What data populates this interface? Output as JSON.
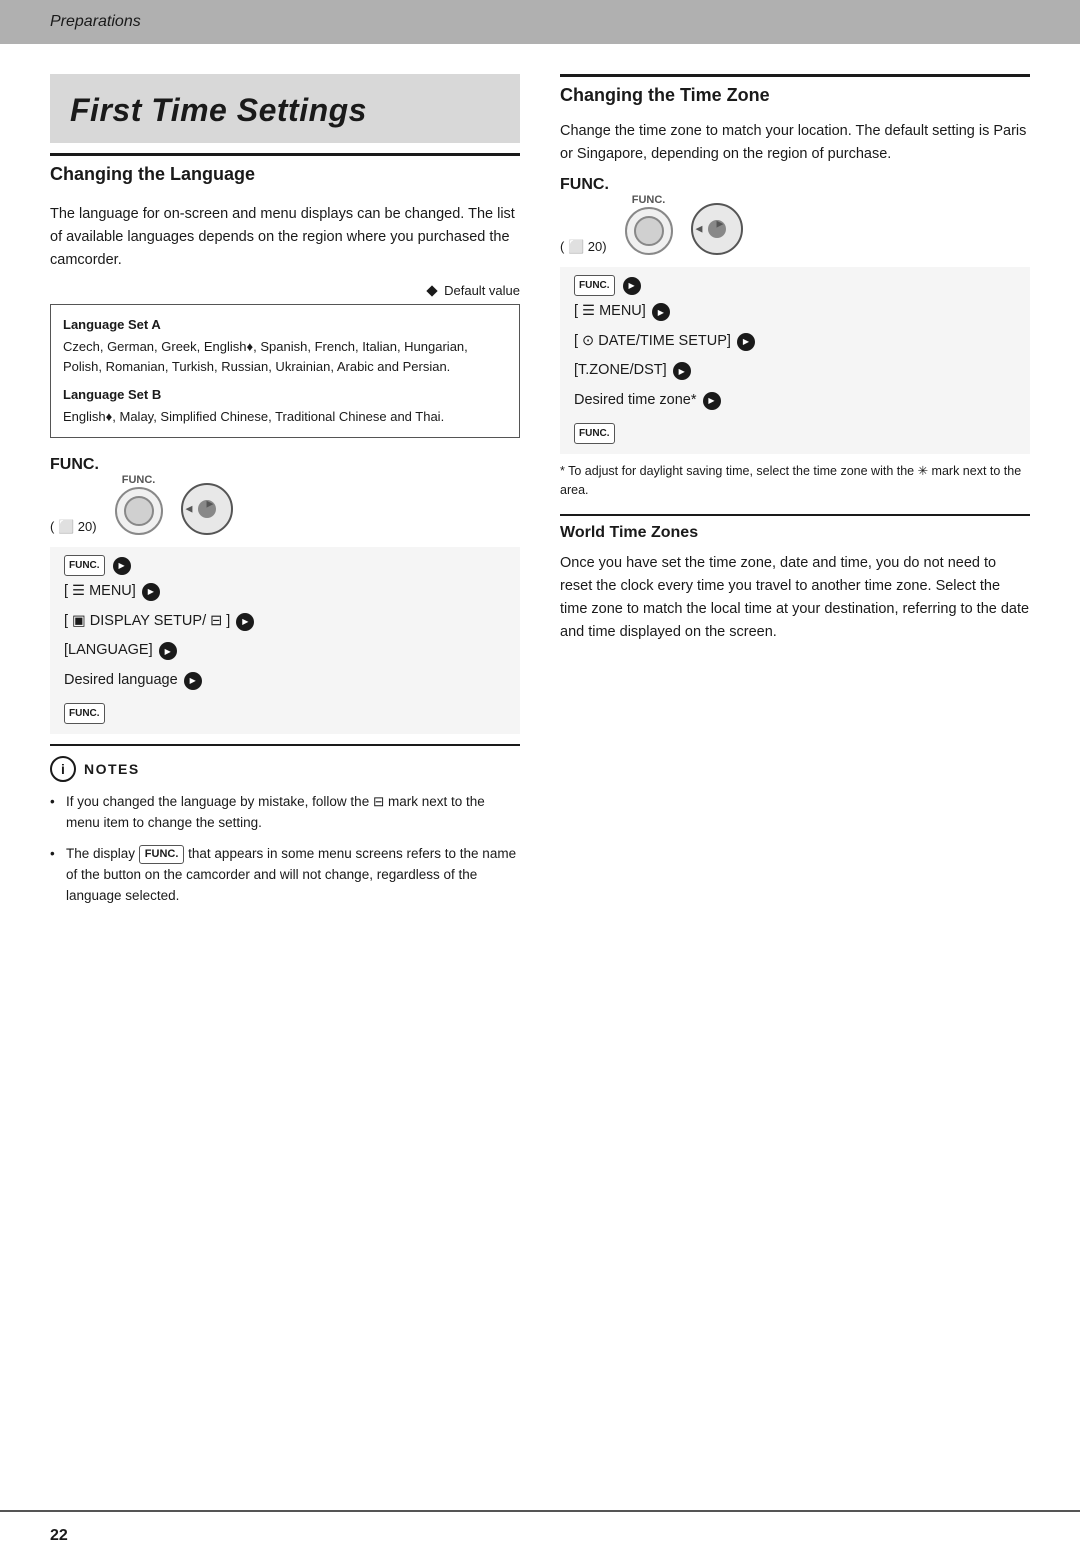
{
  "topBar": {
    "title": "Preparations"
  },
  "leftCol": {
    "mainTitle": "First Time Settings",
    "changingLanguage": {
      "heading": "Changing the Language",
      "bodyText": "The language for on-screen and menu displays can be changed. The list of available languages depends on the region where you purchased the camcorder.",
      "defaultValueLabel": "Default value",
      "languageSetATitle": "Language Set A",
      "languageSetAText": "Czech, German, Greek, English♦, Spanish, French, Italian, Hungarian, Polish, Romanian, Turkish, Russian, Ukrainian, Arabic and Persian.",
      "languageSetBTitle": "Language Set B",
      "languageSetBText": "English♦, Malay, Simplified Chinese, Traditional Chinese and Thai.",
      "funcLabel": "FUNC.",
      "funcParen": "( ⬜ 20)",
      "funcSmallLabel": "FUNC.",
      "menuStep1": "[ ☰ MENU]",
      "menuStep2": "[ ▣ DISPLAY SETUP/ ⊟ ]",
      "menuStep3": "[LANGUAGE]",
      "menuStep4": "Desired language",
      "funcCloseBadge": "FUNC."
    },
    "notes": {
      "heading": "NOTES",
      "note1": "If you changed the language by mistake, follow the ⊟ mark next to the menu item to change the setting.",
      "note2": "The display  FUNC.  that appears in some menu screens refers to the name of the button on the camcorder and will not change, regardless of the language selected."
    }
  },
  "rightCol": {
    "changingTimeZone": {
      "heading": "Changing the Time Zone",
      "bodyText": "Change the time zone to match your location. The default setting is Paris or Singapore, depending on the region of purchase.",
      "funcLabel": "FUNC.",
      "funcParen": "( ⬜ 20)",
      "funcSmallLabel": "FUNC.",
      "menuStep1": "[ ☰ MENU]",
      "menuStep2": "[ ⊙ DATE/TIME SETUP]",
      "menuStep3": "[T.ZONE/DST]",
      "menuStep4": "Desired time zone*",
      "funcCloseBadge": "FUNC.",
      "footnote": "* To adjust for daylight saving time, select the time zone with the ✳ mark next to the area."
    },
    "worldTimeZones": {
      "heading": "World Time Zones",
      "bodyText": "Once you have set the time zone, date and time, you do not need to reset the clock every time you travel to another time zone. Select the time zone to match the local time at your destination, referring to the date and time displayed on the screen."
    }
  },
  "footer": {
    "pageNumber": "22"
  }
}
